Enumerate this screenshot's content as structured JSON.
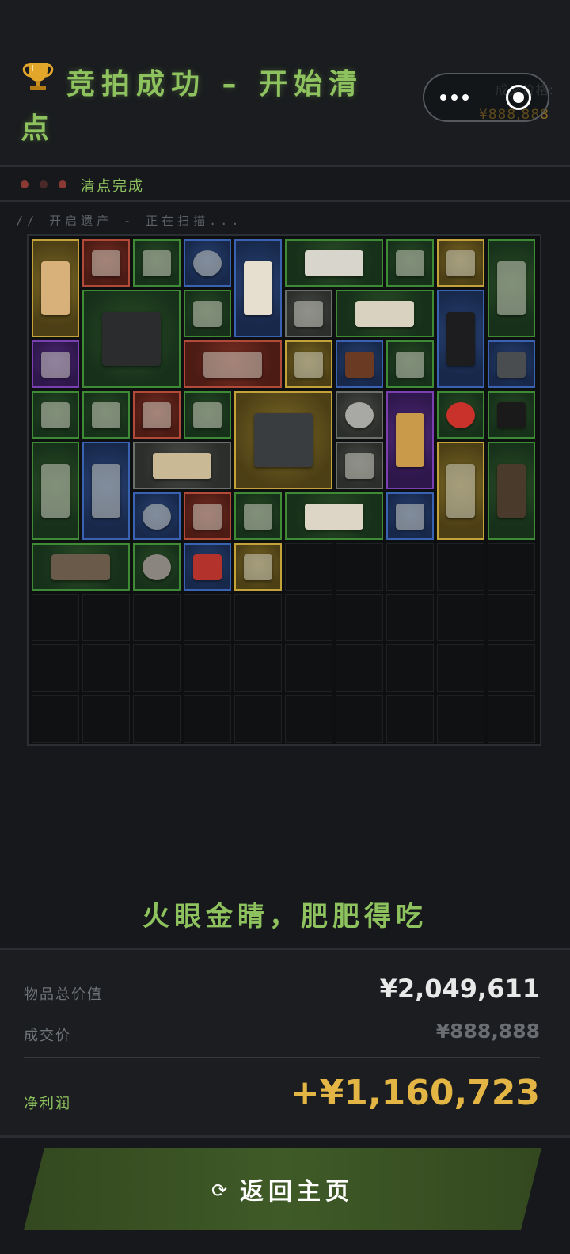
{
  "header": {
    "title": "竞拍成功 – 开始清点",
    "trophy_icon": "trophy-icon",
    "deal_label_ghost": "成交价格:",
    "deal_price_ghost": "¥888,888"
  },
  "status": {
    "dots": [
      "#8a3a33",
      "#4a2a28",
      "#8a3a33"
    ],
    "text": "清点完成"
  },
  "scan_text": "// 开启遗产 - 正在扫描...",
  "grid": {
    "columns": 10,
    "rows": 10,
    "items": [
      {
        "name": "figurine",
        "rarity": "gold",
        "col": 0,
        "row": 0,
        "w": 1,
        "h": 2
      },
      {
        "name": "circuit-module",
        "rarity": "red",
        "col": 1,
        "row": 0,
        "w": 1,
        "h": 1
      },
      {
        "name": "circuit-board",
        "rarity": "green",
        "col": 2,
        "row": 0,
        "w": 1,
        "h": 1
      },
      {
        "name": "capacitor-jar",
        "rarity": "blue",
        "col": 3,
        "row": 0,
        "w": 1,
        "h": 1
      },
      {
        "name": "coffee-pot",
        "rarity": "blue",
        "col": 4,
        "row": 0,
        "w": 1,
        "h": 2
      },
      {
        "name": "keyboard",
        "rarity": "green",
        "col": 5,
        "row": 0,
        "w": 2,
        "h": 1
      },
      {
        "name": "tweezers",
        "rarity": "green",
        "col": 7,
        "row": 0,
        "w": 1,
        "h": 1
      },
      {
        "name": "multimeter",
        "rarity": "gold",
        "col": 8,
        "row": 0,
        "w": 1,
        "h": 1
      },
      {
        "name": "ammo-case",
        "rarity": "green",
        "col": 9,
        "row": 0,
        "w": 1,
        "h": 2
      },
      {
        "name": "power-supply",
        "rarity": "green",
        "col": 1,
        "row": 1,
        "w": 2,
        "h": 2
      },
      {
        "name": "pliers",
        "rarity": "green",
        "col": 3,
        "row": 1,
        "w": 1,
        "h": 1
      },
      {
        "name": "playing-card",
        "rarity": "gray",
        "col": 5,
        "row": 1,
        "w": 1,
        "h": 1
      },
      {
        "name": "old-map",
        "rarity": "green",
        "col": 6,
        "row": 1,
        "w": 2,
        "h": 1
      },
      {
        "name": "gunpowder-can",
        "rarity": "blue",
        "col": 8,
        "row": 1,
        "w": 1,
        "h": 2
      },
      {
        "name": "energy-bar",
        "rarity": "purple",
        "col": 0,
        "row": 2,
        "w": 1,
        "h": 1
      },
      {
        "name": "tablet-device",
        "rarity": "red",
        "col": 3,
        "row": 2,
        "w": 2,
        "h": 1
      },
      {
        "name": "bottle",
        "rarity": "gold",
        "col": 5,
        "row": 2,
        "w": 1,
        "h": 1
      },
      {
        "name": "bird-statue",
        "rarity": "blue",
        "col": 6,
        "row": 2,
        "w": 1,
        "h": 1
      },
      {
        "name": "syringe",
        "rarity": "green",
        "col": 7,
        "row": 2,
        "w": 1,
        "h": 1
      },
      {
        "name": "usb-stick",
        "rarity": "blue",
        "col": 9,
        "row": 2,
        "w": 1,
        "h": 1
      },
      {
        "name": "candy-bar",
        "rarity": "green",
        "col": 0,
        "row": 3,
        "w": 1,
        "h": 1
      },
      {
        "name": "voltage-pen",
        "rarity": "green",
        "col": 1,
        "row": 3,
        "w": 1,
        "h": 1
      },
      {
        "name": "wrist-device",
        "rarity": "red",
        "col": 2,
        "row": 3,
        "w": 1,
        "h": 1
      },
      {
        "name": "snack-bar",
        "rarity": "green",
        "col": 3,
        "row": 3,
        "w": 1,
        "h": 1
      },
      {
        "name": "headset",
        "rarity": "gold",
        "col": 4,
        "row": 3,
        "w": 2,
        "h": 2
      },
      {
        "name": "duct-tape",
        "rarity": "gray",
        "col": 6,
        "row": 3,
        "w": 1,
        "h": 1
      },
      {
        "name": "book",
        "rarity": "purple",
        "col": 7,
        "row": 3,
        "w": 1,
        "h": 2
      },
      {
        "name": "apple",
        "rarity": "green",
        "col": 8,
        "row": 3,
        "w": 1,
        "h": 1
      },
      {
        "name": "good-luck-card",
        "rarity": "green",
        "col": 9,
        "row": 3,
        "w": 1,
        "h": 1
      },
      {
        "name": "ammo-box",
        "rarity": "green",
        "col": 0,
        "row": 4,
        "w": 1,
        "h": 2
      },
      {
        "name": "shell-jar",
        "rarity": "blue",
        "col": 1,
        "row": 4,
        "w": 1,
        "h": 2
      },
      {
        "name": "treasure-map",
        "rarity": "gray",
        "col": 2,
        "row": 4,
        "w": 2,
        "h": 1
      },
      {
        "name": "chip-tray",
        "rarity": "gray",
        "col": 6,
        "row": 4,
        "w": 1,
        "h": 1
      },
      {
        "name": "coffee-machine",
        "rarity": "gold",
        "col": 8,
        "row": 4,
        "w": 1,
        "h": 2
      },
      {
        "name": "tribal-mask",
        "rarity": "green",
        "col": 9,
        "row": 4,
        "w": 1,
        "h": 2
      },
      {
        "name": "capacitor-jar-2",
        "rarity": "blue",
        "col": 2,
        "row": 5,
        "w": 1,
        "h": 1
      },
      {
        "name": "flashlight",
        "rarity": "red",
        "col": 3,
        "row": 5,
        "w": 1,
        "h": 1
      },
      {
        "name": "medicine-bottle",
        "rarity": "green",
        "col": 4,
        "row": 5,
        "w": 1,
        "h": 1
      },
      {
        "name": "paper-notes",
        "rarity": "green",
        "col": 5,
        "row": 5,
        "w": 2,
        "h": 1
      },
      {
        "name": "plug-adapter",
        "rarity": "blue",
        "col": 7,
        "row": 5,
        "w": 1,
        "h": 1
      },
      {
        "name": "drill",
        "rarity": "green",
        "col": 0,
        "row": 6,
        "w": 2,
        "h": 1
      },
      {
        "name": "coin",
        "rarity": "green",
        "col": 2,
        "row": 6,
        "w": 1,
        "h": 1
      },
      {
        "name": "tea-tin",
        "rarity": "blue",
        "col": 3,
        "row": 6,
        "w": 1,
        "h": 1
      },
      {
        "name": "silver-bag",
        "rarity": "gold",
        "col": 4,
        "row": 6,
        "w": 1,
        "h": 1
      }
    ]
  },
  "slogan": "火眼金睛，肥肥得吃",
  "summary": {
    "total_label": "物品总价值",
    "total_value": "¥2,049,611",
    "deal_label": "成交价",
    "deal_value": "¥888,888",
    "profit_label": "净利润",
    "profit_value": "+¥1,160,723"
  },
  "colors": {
    "accent_green": "#8ec25e",
    "profit_gold": "#e3b544",
    "rarity": {
      "green": "#3f8a34",
      "blue": "#3a62b2",
      "red": "#b24a3a",
      "gold": "#c4a23a",
      "purple": "#7a3fb0",
      "gray": "#6c706b"
    }
  },
  "button": {
    "label": "返回主页",
    "icon": "refresh-icon",
    "icon_glyph": "⟳"
  }
}
